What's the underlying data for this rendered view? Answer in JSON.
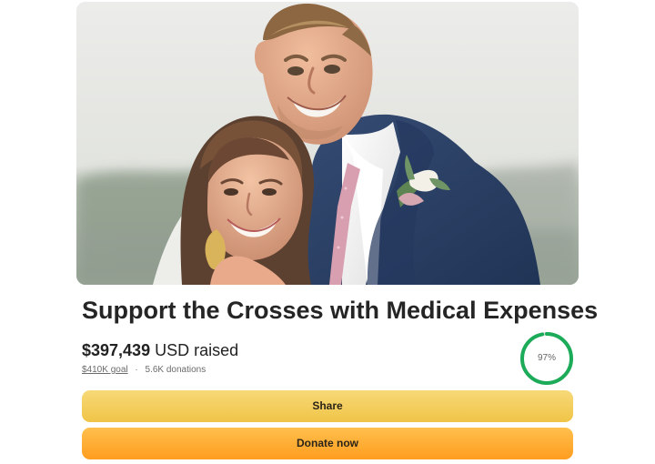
{
  "campaign": {
    "image_alt": "Smiling couple in wedding attire",
    "title": "Support the Crosses with Medical Expenses",
    "raised_amount": "$397,439",
    "raised_suffix": "USD raised",
    "goal_text": "$410K goal",
    "separator": "·",
    "donations_text": "5.6K donations",
    "progress_percent": 97,
    "progress_label": "97%"
  },
  "actions": {
    "share_label": "Share",
    "donate_label": "Donate now"
  },
  "colors": {
    "progress": "#1cab58",
    "progress_track": "#e6e6e6",
    "share_button": "#f3cd5c",
    "donate_button": "#ffaa2f",
    "title_text": "#252525"
  },
  "icons": {
    "progress": "circular-progress-ring"
  }
}
